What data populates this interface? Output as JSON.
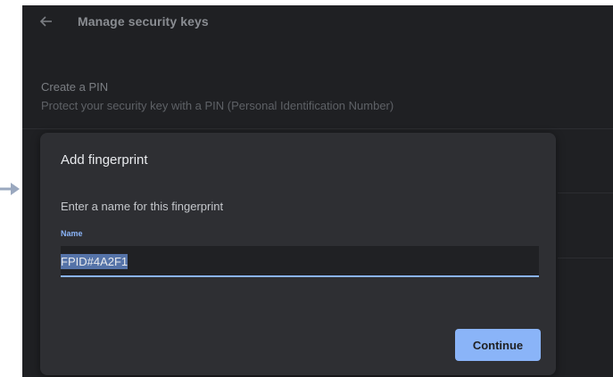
{
  "header": {
    "title": "Manage security keys",
    "back_icon": "back-arrow-icon"
  },
  "settings": {
    "pin_title": "Create a PIN",
    "pin_subtitle": "Protect your security key with a PIN (Personal Identification Number)"
  },
  "dialog": {
    "title": "Add fingerprint",
    "prompt": "Enter a name for this fingerprint",
    "field_label": "Name",
    "field_value": "FPID#4A2F1",
    "continue_label": "Continue"
  },
  "colors": {
    "background": "#1f2023",
    "dialog": "#2e2f33",
    "accent": "#8ab4f8",
    "selection": "#5573a8"
  }
}
